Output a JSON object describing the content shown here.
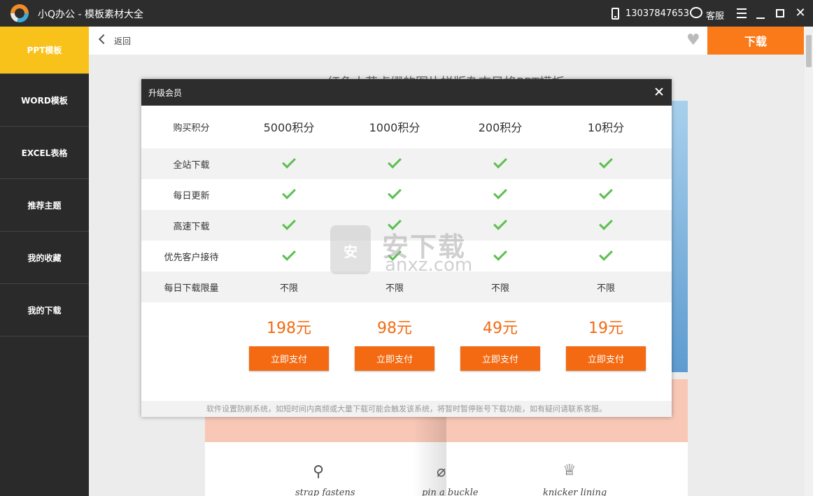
{
  "titlebar": {
    "title": "小Q办公 - 模板素材大全",
    "phone": "13037847653",
    "service": "客服"
  },
  "sidebar": {
    "items": [
      {
        "label": "PPT模板",
        "active": true
      },
      {
        "label": "WORD模板",
        "active": false
      },
      {
        "label": "EXCEL表格",
        "active": false
      },
      {
        "label": "推荐主题",
        "active": false
      },
      {
        "label": "我的收藏",
        "active": false
      },
      {
        "label": "我的下载",
        "active": false
      }
    ]
  },
  "topbar": {
    "back": "返回",
    "download": "下载"
  },
  "background": {
    "title": "红色小花点缀的图片拼版杂志风格PPT模板",
    "captions": [
      "strap fastens",
      "pin a buckle",
      "knicker lining"
    ]
  },
  "modal": {
    "title": "升级会员",
    "header_label": "购买积分",
    "plans": [
      "5000积分",
      "1000积分",
      "200积分",
      "10积分"
    ],
    "features": [
      "全站下载",
      "每日更新",
      "高速下载",
      "优先客户接待"
    ],
    "limit_label": "每日下载限量",
    "limit_values": [
      "不限",
      "不限",
      "不限",
      "不限"
    ],
    "prices": [
      "198元",
      "98元",
      "49元",
      "19元"
    ],
    "pay_label": "立即支付",
    "footnote": "软件设置防刷系统，如短时间内高频或大量下载可能会触发该系统，将暂时暂停账号下载功能，如有疑问请联系客服。"
  },
  "watermark": {
    "big": "安下载",
    "small": "anxz.com",
    "badge": "安"
  },
  "colors": {
    "accent": "#fa7a1a",
    "sidebar_active": "#f9c21b",
    "check": "#5cbf4f",
    "price": "#f26b13"
  }
}
